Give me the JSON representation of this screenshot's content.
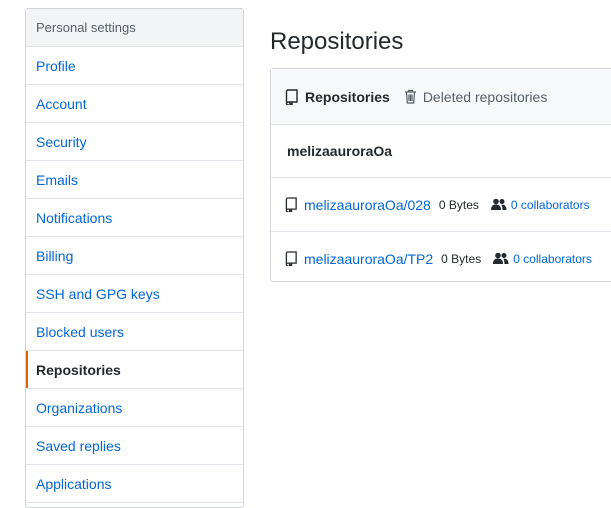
{
  "sidebar": {
    "header": "Personal settings",
    "items": [
      {
        "label": "Profile"
      },
      {
        "label": "Account"
      },
      {
        "label": "Security"
      },
      {
        "label": "Emails"
      },
      {
        "label": "Notifications"
      },
      {
        "label": "Billing"
      },
      {
        "label": "SSH and GPG keys"
      },
      {
        "label": "Blocked users"
      },
      {
        "label": "Repositories",
        "selected": true
      },
      {
        "label": "Organizations"
      },
      {
        "label": "Saved replies"
      },
      {
        "label": "Applications"
      }
    ]
  },
  "main": {
    "title": "Repositories",
    "tabs": [
      {
        "label": "Repositories",
        "icon": "repo-icon",
        "active": true
      },
      {
        "label": "Deleted repositories",
        "icon": "trash-icon",
        "active": false
      }
    ],
    "owner": "melizaauroraOa",
    "repos": [
      {
        "name": "melizaauroraOa/028",
        "size": "0 Bytes",
        "collaborators": "0 collaborators"
      },
      {
        "name": "melizaauroraOa/TP2",
        "size": "0 Bytes",
        "collaborators": "0 collaborators"
      }
    ]
  },
  "colors": {
    "link": "#0366d6",
    "selected_accent": "#e36209"
  }
}
